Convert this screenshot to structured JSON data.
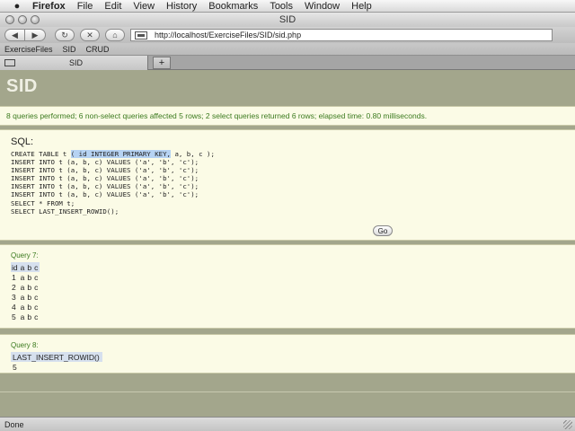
{
  "menubar": {
    "apple": "",
    "items": [
      "Firefox",
      "File",
      "Edit",
      "View",
      "History",
      "Bookmarks",
      "Tools",
      "Window",
      "Help"
    ]
  },
  "window": {
    "title": "SID"
  },
  "toolbar": {
    "back": "◀",
    "forward": "▶",
    "reload": "↻",
    "stop": "✕",
    "home": "⌂",
    "url": "http://localhost/ExerciseFiles/SID/sid.php"
  },
  "bookmarks": [
    "ExerciseFiles",
    "SID",
    "CRUD"
  ],
  "tabs": {
    "active_title": "SID",
    "new_tab": "+"
  },
  "page": {
    "header": "SID",
    "summary": "8 queries performed; 6 non-select queries affected 5 rows; 2 select queries returned 6 rows; elapsed time: 0.80 milliseconds.",
    "sql_label": "SQL:",
    "sql": {
      "line1_pre": "CREATE TABLE t ",
      "line1_hl": "( id INTEGER PRIMARY KEY,",
      "line1_post": " a, b, c );",
      "lines": [
        "INSERT INTO t (a, b, c) VALUES ('a', 'b', 'c');",
        "INSERT INTO t (a, b, c) VALUES ('a', 'b', 'c');",
        "INSERT INTO t (a, b, c) VALUES ('a', 'b', 'c');",
        "INSERT INTO t (a, b, c) VALUES ('a', 'b', 'c');",
        "INSERT INTO t (a, b, c) VALUES ('a', 'b', 'c');",
        "SELECT * FROM t;",
        "SELECT LAST_INSERT_ROWID();"
      ]
    },
    "go_label": "Go",
    "query7": {
      "label": "Query 7:",
      "headers": [
        "id",
        "a",
        "b",
        "c"
      ],
      "rows": [
        [
          "1",
          "a",
          "b",
          "c"
        ],
        [
          "2",
          "a",
          "b",
          "c"
        ],
        [
          "3",
          "a",
          "b",
          "c"
        ],
        [
          "4",
          "a",
          "b",
          "c"
        ],
        [
          "5",
          "a",
          "b",
          "c"
        ]
      ]
    },
    "query8": {
      "label": "Query 8:",
      "header": "LAST_INSERT_ROWID()",
      "value": "5"
    }
  },
  "status": {
    "text": "Done"
  }
}
